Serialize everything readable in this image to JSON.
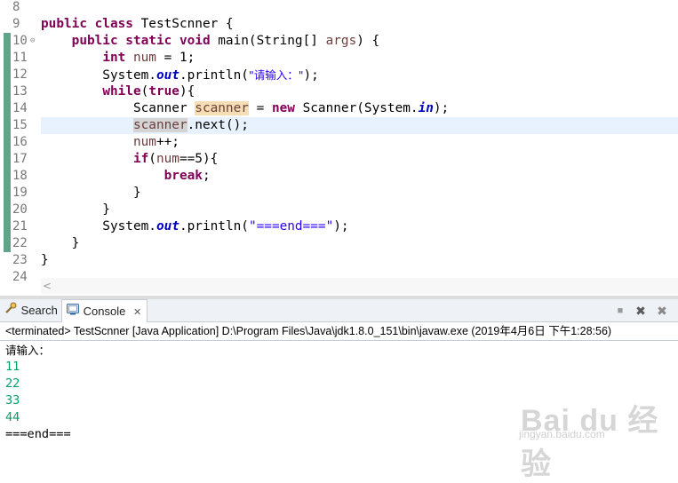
{
  "editor": {
    "lines": [
      {
        "n": "8",
        "tokens": []
      },
      {
        "n": "9",
        "tokens": [
          {
            "t": "public class",
            "c": "kw"
          },
          {
            "t": " TestScnner {"
          }
        ]
      },
      {
        "n": "10",
        "fold": true,
        "marker": true,
        "tokens": [
          {
            "t": "    "
          },
          {
            "t": "public static void",
            "c": "kw"
          },
          {
            "t": " main(String[] "
          },
          {
            "t": "args",
            "c": "var"
          },
          {
            "t": ") {"
          }
        ]
      },
      {
        "n": "11",
        "marker": true,
        "tokens": [
          {
            "t": "        "
          },
          {
            "t": "int",
            "c": "kw"
          },
          {
            "t": " "
          },
          {
            "t": "num",
            "c": "var"
          },
          {
            "t": " = 1;"
          }
        ]
      },
      {
        "n": "12",
        "marker": true,
        "tokens": [
          {
            "t": "        System."
          },
          {
            "t": "out",
            "c": "fld"
          },
          {
            "t": ".println("
          },
          {
            "t": "\"请输入：\"",
            "c": "str strcn"
          },
          {
            "t": ");"
          }
        ]
      },
      {
        "n": "13",
        "marker": true,
        "tokens": [
          {
            "t": "        "
          },
          {
            "t": "while",
            "c": "kw"
          },
          {
            "t": "("
          },
          {
            "t": "true",
            "c": "kw"
          },
          {
            "t": "){"
          }
        ]
      },
      {
        "n": "14",
        "marker": true,
        "tokens": [
          {
            "t": "            Scanner "
          },
          {
            "t": "scanner",
            "c": "var hl"
          },
          {
            "t": " = "
          },
          {
            "t": "new",
            "c": "kw"
          },
          {
            "t": " Scanner(System."
          },
          {
            "t": "in",
            "c": "fld"
          },
          {
            "t": ");"
          }
        ]
      },
      {
        "n": "15",
        "marker": true,
        "current": true,
        "tokens": [
          {
            "t": "            "
          },
          {
            "t": "scanner",
            "c": "var occ"
          },
          {
            "t": ".next();"
          }
        ]
      },
      {
        "n": "16",
        "marker": true,
        "tokens": [
          {
            "t": "            "
          },
          {
            "t": "num",
            "c": "var"
          },
          {
            "t": "++;"
          }
        ]
      },
      {
        "n": "17",
        "marker": true,
        "tokens": [
          {
            "t": "            "
          },
          {
            "t": "if",
            "c": "kw"
          },
          {
            "t": "("
          },
          {
            "t": "num",
            "c": "var"
          },
          {
            "t": "==5){"
          }
        ]
      },
      {
        "n": "18",
        "marker": true,
        "tokens": [
          {
            "t": "                "
          },
          {
            "t": "break",
            "c": "kw"
          },
          {
            "t": ";"
          }
        ]
      },
      {
        "n": "19",
        "marker": true,
        "tokens": [
          {
            "t": "            }"
          }
        ]
      },
      {
        "n": "20",
        "marker": true,
        "tokens": [
          {
            "t": "        }"
          }
        ]
      },
      {
        "n": "21",
        "marker": true,
        "tokens": [
          {
            "t": "        System."
          },
          {
            "t": "out",
            "c": "fld"
          },
          {
            "t": ".println("
          },
          {
            "t": "\"===end===\"",
            "c": "str"
          },
          {
            "t": ");"
          }
        ]
      },
      {
        "n": "22",
        "marker": true,
        "tokens": [
          {
            "t": "    }"
          }
        ]
      },
      {
        "n": "23",
        "tokens": [
          {
            "t": "}"
          }
        ]
      },
      {
        "n": "24",
        "tokens": []
      }
    ],
    "scroll_left_arrow": "<"
  },
  "console": {
    "tabs": {
      "search_label": "Search",
      "console_label": "Console",
      "close_glyph": "✕"
    },
    "tools": {
      "terminate": "■",
      "remove": "✖",
      "remove_all": "✖"
    },
    "info": "<terminated> TestScnner [Java Application] D:\\Program Files\\Java\\jdk1.8.0_151\\bin\\javaw.exe (2019年4月6日 下午1:28:56)",
    "output": [
      {
        "text": "请输入：",
        "kind": "prompt"
      },
      {
        "text": "11",
        "kind": "input"
      },
      {
        "text": "22",
        "kind": "input"
      },
      {
        "text": "33",
        "kind": "input"
      },
      {
        "text": "44",
        "kind": "input"
      },
      {
        "text": "===end===",
        "kind": "plain"
      }
    ]
  },
  "watermark": {
    "logo": "Bai du 经验",
    "url": "jingyan.baidu.com"
  },
  "colors": {
    "keyword": "#7f0055",
    "local_var": "#6a3e3e",
    "field": "#0000c0",
    "string": "#2a00ff",
    "console_input": "#00a068",
    "current_line": "#e8f2fe"
  }
}
